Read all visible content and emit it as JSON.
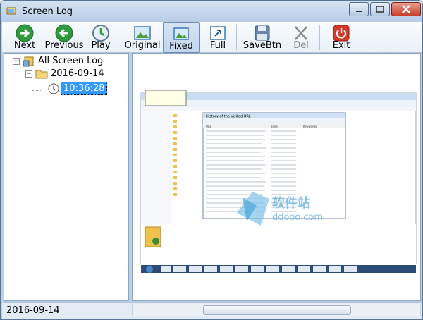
{
  "window": {
    "title": "Screen Log"
  },
  "toolbar": {
    "next": "Next",
    "previous": "Previous",
    "play": "Play",
    "original": "Original",
    "fixed": "Fixed",
    "full": "Full",
    "savebtn": "SaveBtn",
    "del": "Del",
    "exit": "Exit"
  },
  "tree": {
    "root": "All Screen Log",
    "date": "2016-09-14",
    "time": "10:36:28"
  },
  "status": {
    "date": "2016-09-14"
  },
  "preview": {
    "dialog_title": "History of the visited URL",
    "watermark": "ddooo.com",
    "watermark_cn": "软件站",
    "columns": [
      "URL",
      "Time",
      "Keywords"
    ]
  },
  "colors": {
    "next_green": "#2d9a3b",
    "exit_red": "#d23b2a",
    "selection_blue": "#3399ff"
  }
}
